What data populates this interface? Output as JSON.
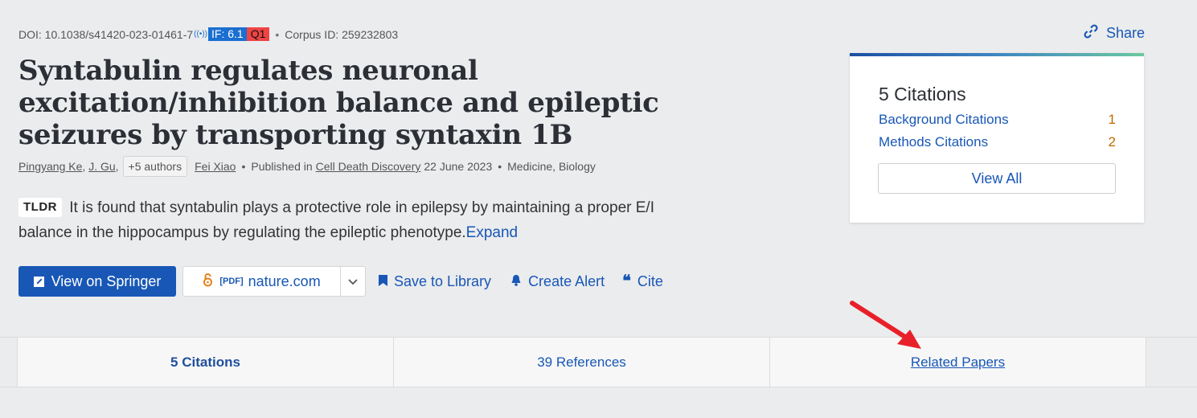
{
  "meta": {
    "doi": "DOI: 10.1038/s41420-023-01461-7",
    "if_badge": "IF: 6.1",
    "q_badge": "Q1",
    "corpus_id": "Corpus ID: 259232803"
  },
  "title": "Syntabulin regulates neuronal excitation/inhibition balance and epileptic seizures by transporting syntaxin 1B",
  "authors": {
    "author1": "Pingyang Ke",
    "author2": "J. Gu",
    "more": "+5 authors",
    "author3": "Fei Xiao",
    "published_in": "Published in",
    "venue": "Cell Death Discovery",
    "date": "22 June 2023",
    "fields": "Medicine, Biology"
  },
  "tldr": {
    "badge": "TLDR",
    "text": "It is found that syntabulin plays a protective role in epilepsy by maintaining a proper E/I balance in the hippocampus by regulating the epileptic phenotype.",
    "expand": "Expand"
  },
  "actions": {
    "view_on": "View on Springer",
    "pdf_tag": "[PDF]",
    "pdf_source": "nature.com",
    "save": "Save to Library",
    "alert": "Create Alert",
    "cite": "Cite"
  },
  "share": "Share",
  "citations_card": {
    "title": "5 Citations",
    "rows": [
      {
        "label": "Background Citations",
        "count": "1"
      },
      {
        "label": "Methods Citations",
        "count": "2"
      }
    ],
    "view_all": "View All"
  },
  "tabs": [
    {
      "label": "5 Citations"
    },
    {
      "label": "39 References"
    },
    {
      "label": "Related Papers"
    }
  ],
  "colors": {
    "accent": "#1857b6",
    "count": "#c06a00",
    "if_badge": "#1a6fd1",
    "q_badge": "#ef4444",
    "arrow": "#e8202a"
  }
}
